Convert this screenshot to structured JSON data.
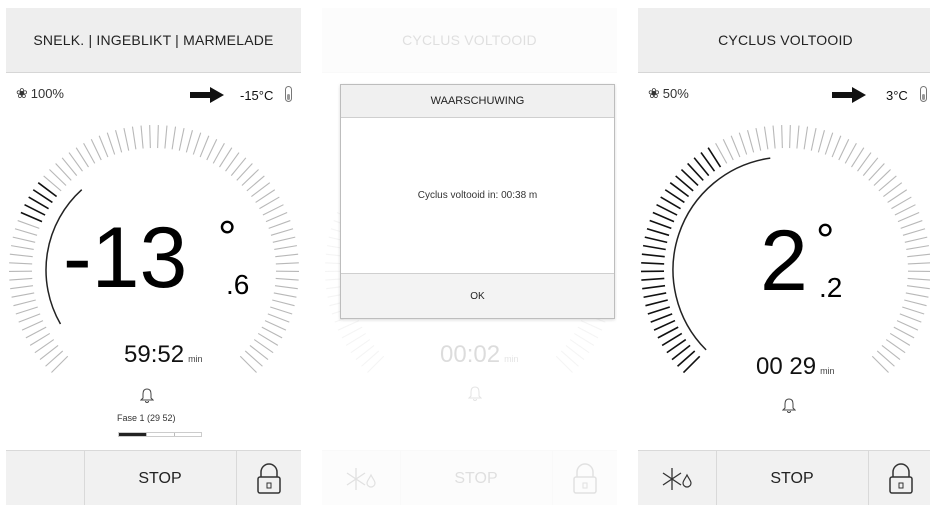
{
  "panel1": {
    "header": "SNELK. | INGEBLIKT | MARMELADE",
    "fan": "100%",
    "set_temp": "-15°C",
    "temp_int": "-13",
    "degree": "°",
    "temp_dec": ".6",
    "timer": "59:52",
    "timer_unit": "min",
    "phase_label": "Fase 1 (29 52)",
    "phase_progress": 0.33,
    "stop": "STOP"
  },
  "panel2": {
    "header": "CYCLUS VOLTOOID",
    "timer": "00:02",
    "timer_unit": "min",
    "stop": "STOP",
    "dialog": {
      "title": "WAARSCHUWING",
      "message": "Cyclus voltooid in: 00:38 m",
      "ok": "OK"
    }
  },
  "panel3": {
    "header": "CYCLUS VOLTOOID",
    "fan": "50%",
    "set_temp": "3°C",
    "temp_int": "2",
    "degree": "°",
    "temp_dec": ".2",
    "timer": "00 29",
    "timer_unit": "min",
    "stop": "STOP"
  },
  "icons": {
    "fan": "fan-icon",
    "arrow": "arrow-right-icon",
    "thermometer": "thermometer-icon",
    "bell": "bell-icon",
    "lock": "lock-icon",
    "snowflake_drop": "snowflake-drop-icon"
  },
  "colors": {
    "active_tick": "#111111",
    "inactive_tick": "#b8b8b8",
    "header_bg": "#eeeeee"
  }
}
